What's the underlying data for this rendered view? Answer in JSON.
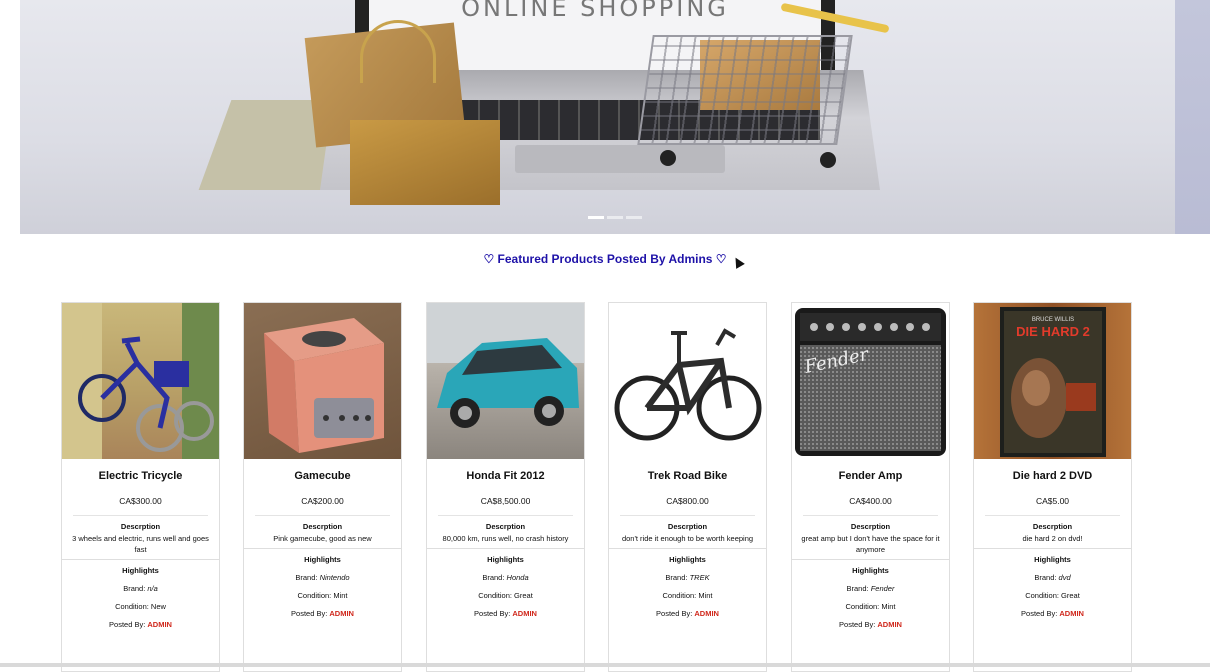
{
  "hero": {
    "banner_text": "ONLINE SHOPPING",
    "slide_count": 3,
    "active_slide": 1
  },
  "section": {
    "title": "♡ Featured Products Posted By Admins ♡"
  },
  "labels": {
    "description": "Descrption",
    "highlights": "Highlights",
    "brand": "Brand: ",
    "condition": "Condition: ",
    "posted_by": "Posted By: "
  },
  "products": [
    {
      "title": "Electric Tricycle",
      "price": "CA$300.00",
      "description": "3 wheels and electric, runs well and goes fast",
      "brand": "n/a",
      "condition": "New",
      "posted_by": "ADMIN"
    },
    {
      "title": "Gamecube",
      "price": "CA$200.00",
      "description": "Pink gamecube, good as new",
      "brand": "Nintendo",
      "condition": "Mint",
      "posted_by": "ADMIN"
    },
    {
      "title": "Honda Fit 2012",
      "price": "CA$8,500.00",
      "description": "80,000 km, runs well, no crash history",
      "brand": "Honda",
      "condition": "Great",
      "posted_by": "ADMIN"
    },
    {
      "title": "Trek Road Bike",
      "price": "CA$800.00",
      "description": "don't ride it enough to be worth keeping",
      "brand": "TREK",
      "condition": "Mint",
      "posted_by": "ADMIN"
    },
    {
      "title": "Fender Amp",
      "price": "CA$400.00",
      "description": "great amp but I don't have the space for it anymore",
      "brand": "Fender",
      "condition": "Mint",
      "posted_by": "ADMIN"
    },
    {
      "title": "Die hard 2 DVD",
      "price": "CA$5.00",
      "description": "die hard 2 on dvd!",
      "brand": "dvd",
      "condition": "Great",
      "posted_by": "ADMIN"
    }
  ],
  "image_text": {
    "fender_logo": "Fender",
    "dvd_title": "DIE HARD 2",
    "dvd_actor": "BRUCE WILLIS"
  },
  "colors": {
    "title": "#1e12a8",
    "admin": "#d0281c"
  }
}
